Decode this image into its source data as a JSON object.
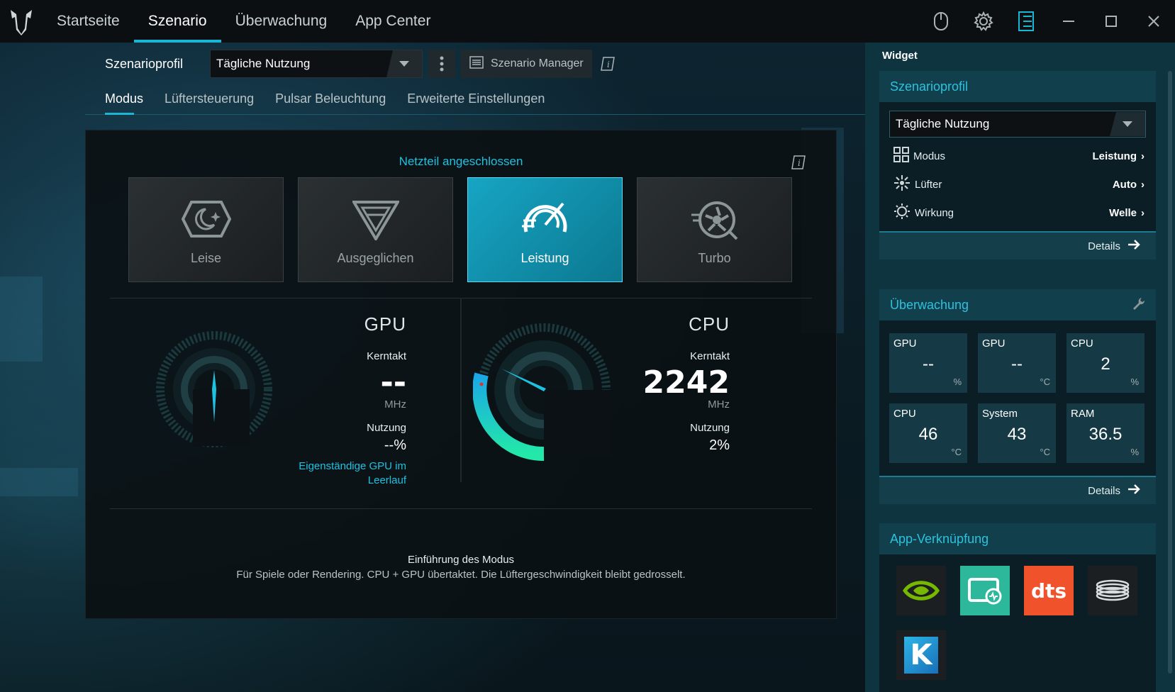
{
  "nav": {
    "tabs": [
      {
        "label": "Startseite"
      },
      {
        "label": "Szenario"
      },
      {
        "label": "Überwachung"
      },
      {
        "label": "App Center"
      }
    ],
    "active": "Szenario"
  },
  "profile": {
    "label": "Szenarioprofil",
    "selected": "Tägliche Nutzung",
    "manager_label": "Szenario Manager"
  },
  "subtabs": [
    {
      "label": "Modus"
    },
    {
      "label": "Lüftersteuerung"
    },
    {
      "label": "Pulsar Beleuchtung"
    },
    {
      "label": "Erweiterte Einstellungen"
    }
  ],
  "main": {
    "power_status": "Netzteil angeschlossen",
    "modes": [
      {
        "label": "Leise",
        "icon": "moon-icon"
      },
      {
        "label": "Ausgeglichen",
        "icon": "triangle-icon"
      },
      {
        "label": "Leistung",
        "icon": "speedometer-icon"
      },
      {
        "label": "Turbo",
        "icon": "turbine-icon"
      }
    ],
    "active_mode": "Leistung",
    "gpu": {
      "name": "GPU",
      "clock_label": "Kerntakt",
      "clock_value": "--",
      "clock_unit": "MHz",
      "usage_label": "Nutzung",
      "usage_value": "--%",
      "note": "Eigenständige GPU im Leerlauf"
    },
    "cpu": {
      "name": "CPU",
      "clock_label": "Kerntakt",
      "clock_value": "2242",
      "clock_unit": "MHz",
      "usage_label": "Nutzung",
      "usage_value": "2%"
    },
    "intro_title": "Einführung des Modus",
    "intro_desc": "Für Spiele oder Rendering. CPU + GPU übertaktet. Die Lüftergeschwindigkeit bleibt gedrosselt."
  },
  "widget": {
    "title": "Widget",
    "scenario": {
      "title": "Szenarioprofil",
      "selected": "Tägliche Nutzung",
      "rows": [
        {
          "label": "Modus",
          "value": "Leistung",
          "icon": "grid-icon"
        },
        {
          "label": "Lüfter",
          "value": "Auto",
          "icon": "fan-icon"
        },
        {
          "label": "Wirkung",
          "value": "Welle",
          "icon": "light-icon"
        }
      ],
      "details": "Details"
    },
    "monitor": {
      "title": "Überwachung",
      "tiles": [
        {
          "label": "GPU",
          "value": "--",
          "unit": "%"
        },
        {
          "label": "GPU",
          "value": "--",
          "unit": "°C"
        },
        {
          "label": "CPU",
          "value": "2",
          "unit": "%"
        },
        {
          "label": "CPU",
          "value": "46",
          "unit": "°C"
        },
        {
          "label": "System",
          "value": "43",
          "unit": "°C"
        },
        {
          "label": "RAM",
          "value": "36.5",
          "unit": "%"
        }
      ],
      "details": "Details"
    },
    "apps": {
      "title": "App-Verknüpfung",
      "items": [
        {
          "name": "nvidia-icon"
        },
        {
          "name": "monitor-app-icon"
        },
        {
          "name": "dts-icon",
          "text": "dts"
        },
        {
          "name": "coil-icon"
        },
        {
          "name": "k-app-icon",
          "text": "K"
        }
      ]
    }
  },
  "colors": {
    "accent": "#19b6d6",
    "active_mode": "#16a5c4",
    "gauge_start": "#1aa6e8",
    "gauge_end": "#23e8a8"
  }
}
